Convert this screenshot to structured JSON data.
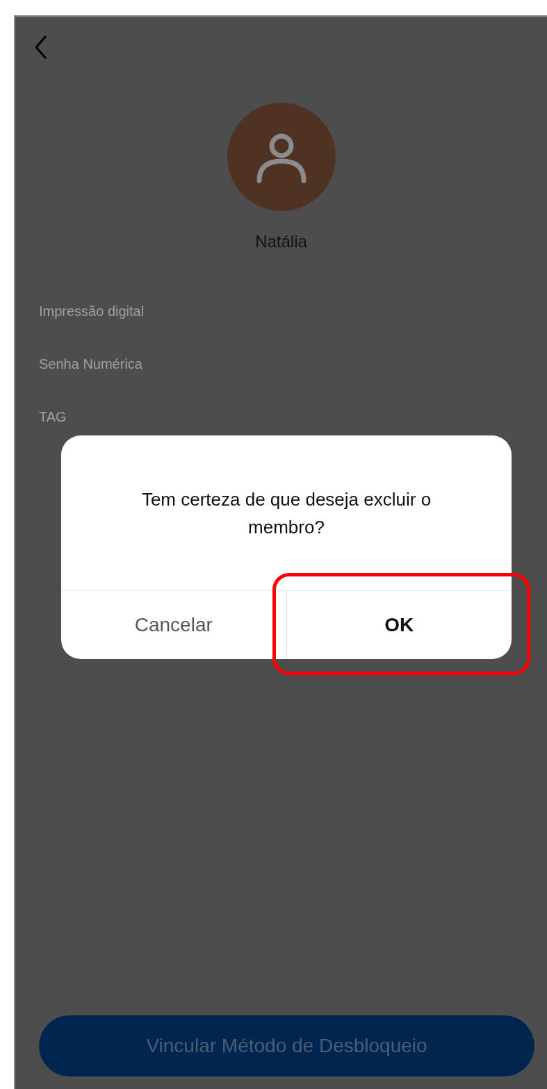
{
  "profile": {
    "name": "Natália"
  },
  "methods": [
    {
      "label": "Impressão digital"
    },
    {
      "label": "Senha Numérica"
    },
    {
      "label": "TAG"
    }
  ],
  "dialog": {
    "message": "Tem certeza de que deseja excluir o membro?",
    "buttons": [
      {
        "label": "Cancelar",
        "kind": "cancel",
        "highlighted": false
      },
      {
        "label": "OK",
        "kind": "confirm",
        "highlighted": true
      }
    ]
  },
  "primary_button": {
    "label": "Vincular Método de Desbloqueio"
  }
}
